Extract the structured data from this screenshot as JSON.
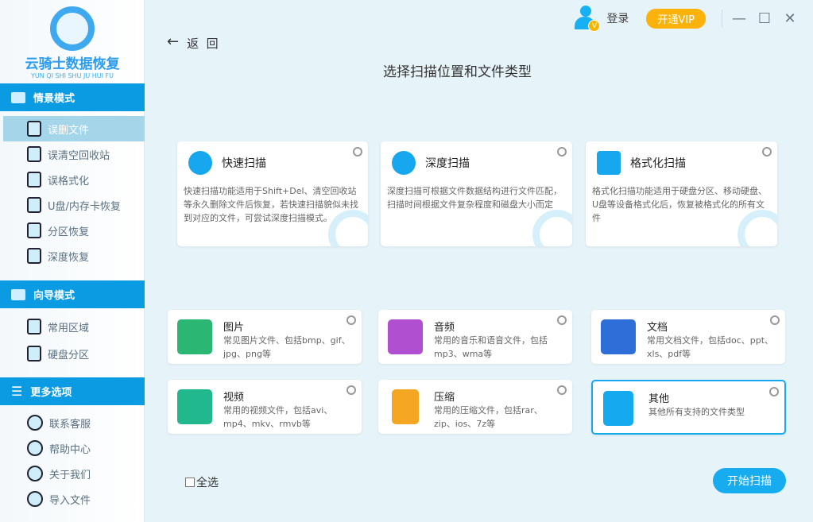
{
  "app": {
    "name": "云骑士数据恢复",
    "pinyin": "YUN QI SHI SHU JU HUI FU"
  },
  "sidebar": {
    "sections": [
      {
        "label": "情景模式",
        "items": [
          "误删文件",
          "误清空回收站",
          "误格式化",
          "U盘/内存卡恢复",
          "分区恢复",
          "深度恢复"
        ]
      },
      {
        "label": "向导模式",
        "items": [
          "常用区域",
          "硬盘分区"
        ]
      },
      {
        "label": "更多选项",
        "items": [
          "联系客服",
          "帮助中心",
          "关于我们",
          "导入文件"
        ]
      }
    ],
    "active": "误删文件"
  },
  "topbar": {
    "login": "登录",
    "vip": "开通VIP",
    "badge": "V"
  },
  "back": {
    "arrow": "←",
    "label": "返  回"
  },
  "title": "选择扫描位置和文件类型",
  "scan_modes": [
    {
      "name": "快速扫描",
      "desc": "快速扫描功能适用于Shift+Del、清空回收站等永久删除文件后恢复，若快速扫描貌似未找到对应的文件，可尝试深度扫描模式。",
      "color": "#17a7ee"
    },
    {
      "name": "深度扫描",
      "desc": "深度扫描可根据文件数据结构进行文件匹配，扫描时间根据文件复杂程度和磁盘大小而定",
      "color": "#17a7ee"
    },
    {
      "name": "格式化扫描",
      "desc": "格式化扫描功能适用于硬盘分区、移动硬盘、U盘等设备格式化后，恢复被格式化的所有文件",
      "color": "#17a7ee"
    }
  ],
  "file_types": [
    {
      "name": "图片",
      "desc": "常见图片文件、包括bmp、gif、jpg、png等",
      "color": "#2bb673"
    },
    {
      "name": "音频",
      "desc": "常用的音乐和语音文件，包括mp3、wma等",
      "color": "#b04fd0"
    },
    {
      "name": "文档",
      "desc": "常用文档文件，包括doc、ppt、xls、pdf等",
      "color": "#2e6ed8"
    },
    {
      "name": "视频",
      "desc": "常用的视频文件，包括avi、mp4、mkv、rmvb等",
      "color": "#22b88e"
    },
    {
      "name": "压缩",
      "desc": "常用的压缩文件，包括rar、zip、ios、7z等",
      "color": "#f5a623"
    },
    {
      "name": "其他",
      "desc": "其他所有支持的文件类型",
      "color": "#15aaf0"
    }
  ],
  "select_all": "全选",
  "start_button": "开始扫描"
}
